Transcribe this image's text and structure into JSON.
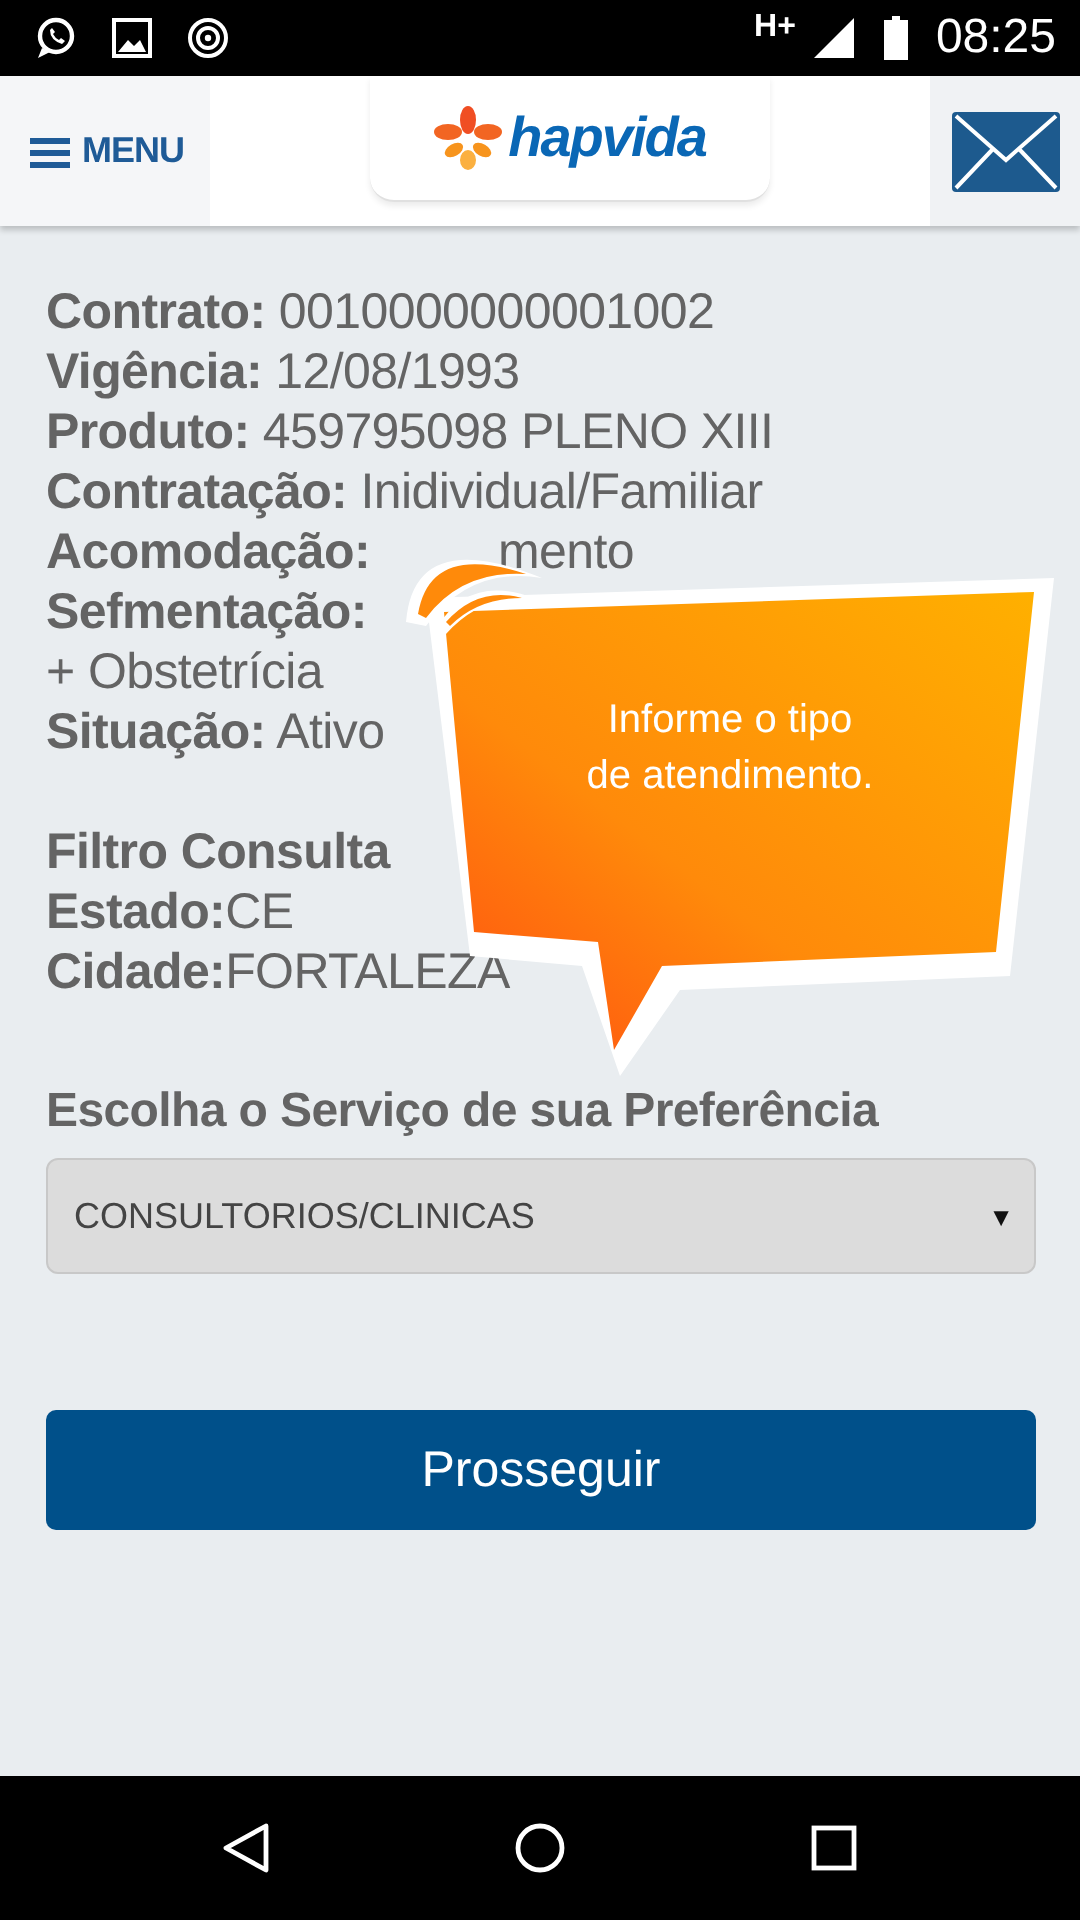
{
  "status_bar": {
    "network": "H+",
    "time": "08:25"
  },
  "header": {
    "menu_label": "MENU",
    "logo_text": "hapvida"
  },
  "details": [
    {
      "label": "Contrato:",
      "value": " 0010000000001002"
    },
    {
      "label": "Vigência:",
      "value": " 12/08/1993"
    },
    {
      "label": "Produto:",
      "value": " 459795098 PLENO XIII"
    },
    {
      "label": "Contratação:",
      "value": " Inidividual/Familiar"
    },
    {
      "label": "Acomodação:",
      "value": "mento",
      "kind": "partly_hidden"
    },
    {
      "label": "Sefmentação:",
      "kind": "hidden"
    },
    {
      "value": "+ Obstetrícia"
    },
    {
      "label": "Situação:",
      "value": " Ativo"
    }
  ],
  "filter": {
    "title": "Filtro Consulta",
    "lines": [
      {
        "label": "Estado:",
        "value": "CE"
      },
      {
        "label": "Cidade:",
        "value": "FORTALEZA"
      }
    ]
  },
  "service": {
    "title": "Escolha o Serviço de sua Preferência",
    "value": "CONSULTORIOS/CLINICAS",
    "arrow": "▼"
  },
  "submit_button": "Prosseguir",
  "tooltip": {
    "lines": [
      "Informe o tipo",
      "de atendimento."
    ]
  }
}
